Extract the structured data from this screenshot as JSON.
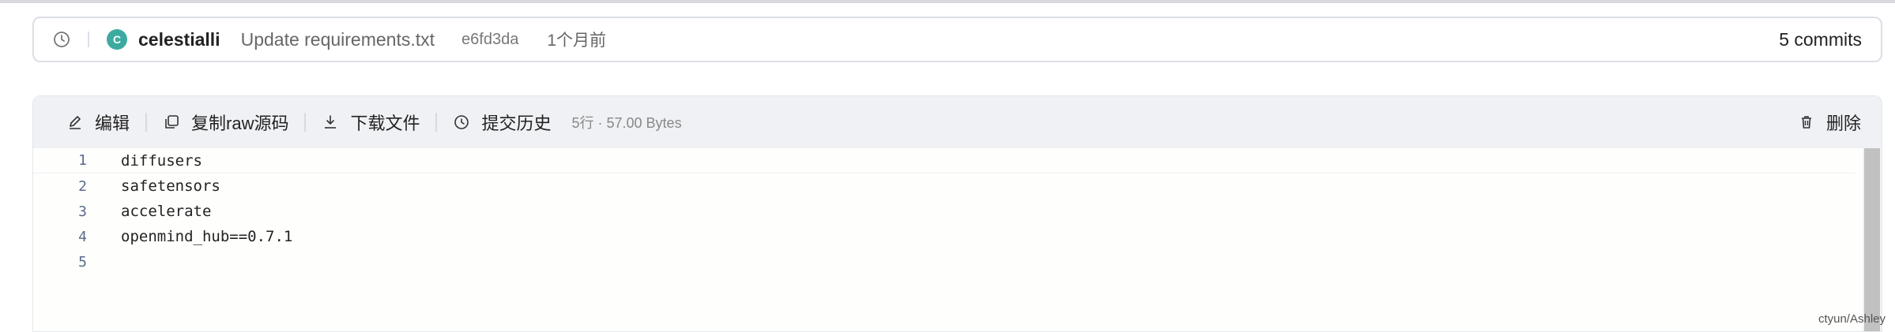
{
  "commit": {
    "avatar_letter": "C",
    "author": "celestialli",
    "message": "Update requirements.txt",
    "hash": "e6fd3da",
    "time": "1个月前",
    "commits_count": "5 commits"
  },
  "toolbar": {
    "edit_label": "编辑",
    "copy_raw_label": "复制raw源码",
    "download_label": "下载文件",
    "history_label": "提交历史",
    "file_meta": "5行 · 57.00 Bytes",
    "delete_label": "删除"
  },
  "code": {
    "lines": [
      {
        "num": "1",
        "text": "diffusers"
      },
      {
        "num": "2",
        "text": "safetensors"
      },
      {
        "num": "3",
        "text": "accelerate"
      },
      {
        "num": "4",
        "text": "openmind_hub==0.7.1"
      },
      {
        "num": "5",
        "text": ""
      }
    ]
  },
  "watermark": "ctyun/Ashley",
  "colors": {
    "avatar_bg": "#3daaa0",
    "toolbar_bg": "#f0f1f4",
    "line_number": "#5a6a8a"
  }
}
